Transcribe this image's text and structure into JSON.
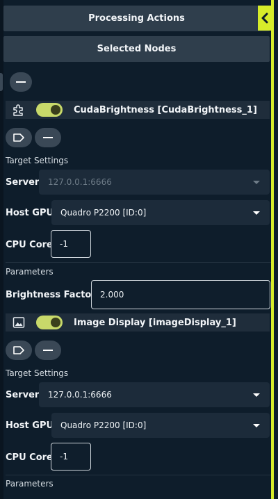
{
  "panel": {
    "title": "Processing Actions",
    "section_title": "Selected Nodes"
  },
  "nodes": [
    {
      "icon": "puzzle-icon",
      "enabled": true,
      "title": "CudaBrightness  [CudaBrightness_1]",
      "target_settings_label": "Target Settings",
      "server_label": "Server",
      "server_value": "127.0.0.1:6666",
      "server_disabled": true,
      "gpu_label": "Host GPU",
      "gpu_value": "Quadro P2200 [ID:0]",
      "cpu_label": "CPU Core",
      "cpu_value": "-1",
      "parameters_label": "Parameters",
      "param_label": "Brightness Factor:",
      "param_value": "2.000"
    },
    {
      "icon": "image-icon",
      "enabled": true,
      "title": "Image Display  [imageDisplay_1]",
      "target_settings_label": "Target Settings",
      "server_label": "Server",
      "server_value": "127.0.0.1:6666",
      "server_disabled": false,
      "gpu_label": "Host GPU",
      "gpu_value": "Quadro P2200 [ID:0]",
      "cpu_label": "CPU Core",
      "cpu_value": "-1",
      "parameters_label": "Parameters"
    }
  ],
  "colors": {
    "accent": "#d7ec2a",
    "toggle_on": "#c8d96a",
    "background": "#0e1d2b",
    "header": "#2f3e4c"
  }
}
